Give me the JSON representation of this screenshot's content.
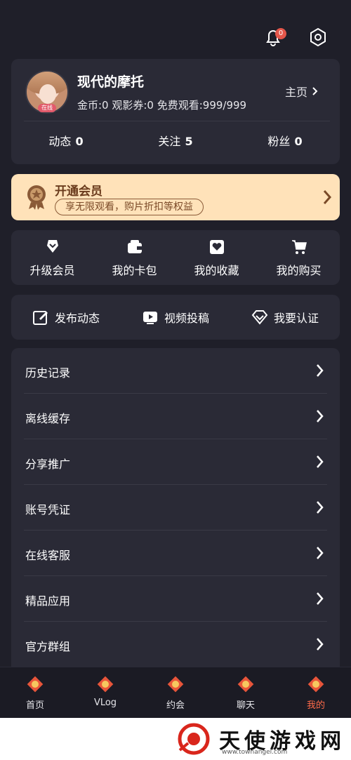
{
  "header": {
    "bell_badge": "0"
  },
  "profile": {
    "name": "现代的摩托",
    "stats_line": "金币:0  观影券:0  免费观看:999/999",
    "home_label": "主页",
    "avatar_tag": "在线",
    "counts": [
      {
        "label": "动态",
        "value": "0"
      },
      {
        "label": "关注",
        "value": "5"
      },
      {
        "label": "粉丝",
        "value": "0"
      }
    ]
  },
  "vip": {
    "title": "开通会员",
    "subtitle": "享无限观看，购片折扣等权益"
  },
  "quick": [
    {
      "label": "升级会员",
      "icon": "vip-shield-icon"
    },
    {
      "label": "我的卡包",
      "icon": "wallet-icon"
    },
    {
      "label": "我的收藏",
      "icon": "favorite-box-icon"
    },
    {
      "label": "我的购买",
      "icon": "cart-icon"
    }
  ],
  "actions": [
    {
      "label": "发布动态",
      "icon": "edit-icon"
    },
    {
      "label": "视频投稿",
      "icon": "video-upload-icon"
    },
    {
      "label": "我要认证",
      "icon": "diamond-icon"
    }
  ],
  "menu": [
    "历史记录",
    "离线缓存",
    "分享推广",
    "账号凭证",
    "在线客服",
    "精品应用",
    "官方群组"
  ],
  "tabs": [
    {
      "label": "首页",
      "active": false
    },
    {
      "label": "VLog",
      "active": false
    },
    {
      "label": "约会",
      "active": false
    },
    {
      "label": "聊天",
      "active": false
    },
    {
      "label": "我的",
      "active": true
    }
  ],
  "watermark": {
    "text": "天使游戏网",
    "url": "www.townangel.com"
  },
  "colors": {
    "background": "#1f1f29",
    "card": "#2a2a36",
    "vip_bg": "#ffe2b9",
    "accent": "#ff6b4a"
  }
}
